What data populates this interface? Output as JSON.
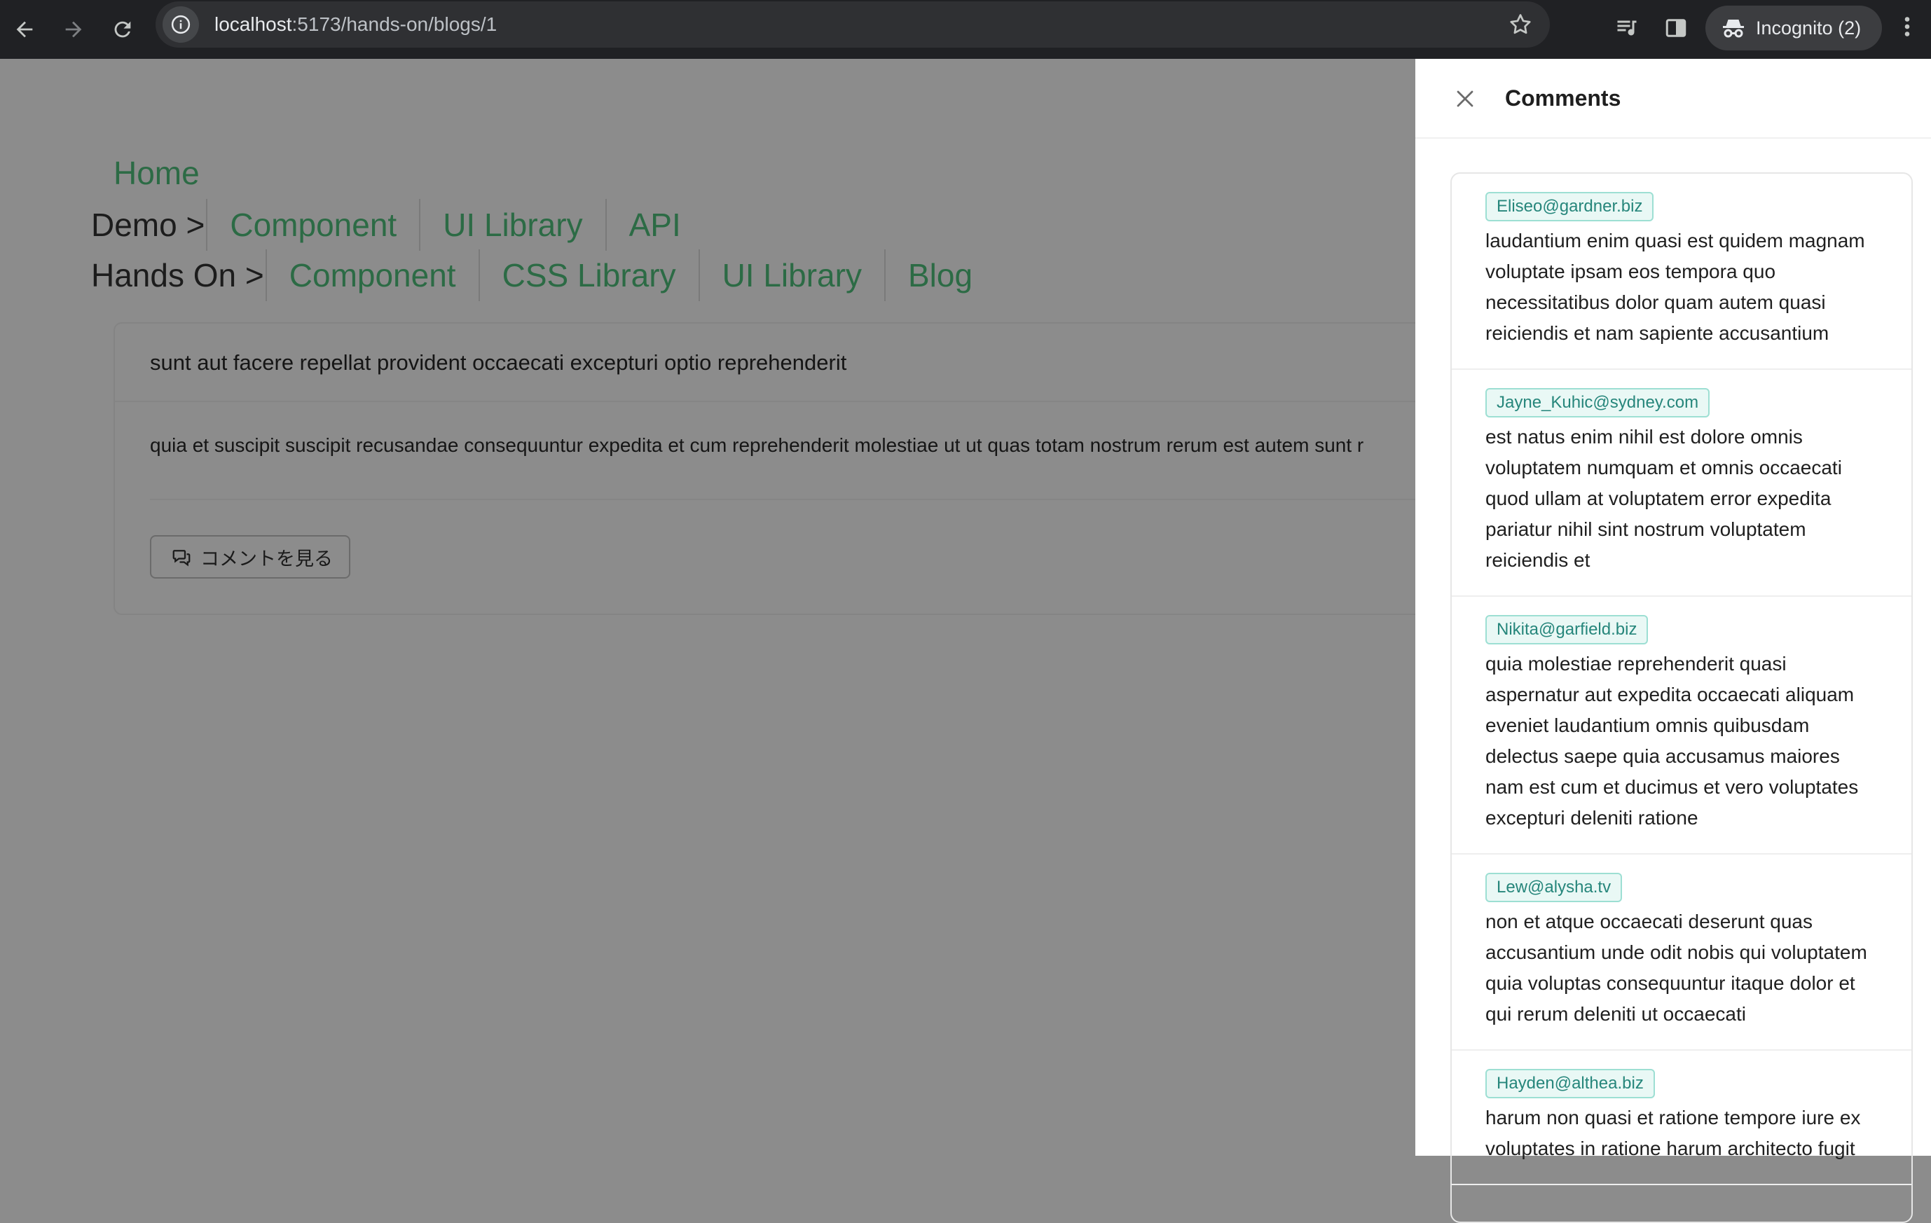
{
  "browser": {
    "url_host": "localhost",
    "url_path": ":5173/hands-on/blogs/1",
    "incognito_label": "Incognito (2)"
  },
  "nav": {
    "home": "Home",
    "demo_label": "Demo >",
    "demo_links": [
      "Component",
      "UI Library",
      "API"
    ],
    "handson_label": "Hands On >",
    "handson_links": [
      "Component",
      "CSS Library",
      "UI Library",
      "Blog"
    ]
  },
  "post": {
    "title": "sunt aut facere repellat provident occaecati excepturi optio reprehenderit",
    "body": "quia et suscipit suscipit recusandae consequuntur expedita et cum reprehenderit molestiae ut ut quas totam nostrum rerum est autem sunt r",
    "comment_button": "コメントを見る"
  },
  "drawer": {
    "title": "Comments",
    "comments": [
      {
        "email": "Eliseo@gardner.biz",
        "body": "laudantium enim quasi est quidem magnam voluptate ipsam eos tempora quo necessitatibus dolor quam autem quasi reiciendis et nam sapiente accusantium"
      },
      {
        "email": "Jayne_Kuhic@sydney.com",
        "body": "est natus enim nihil est dolore omnis voluptatem numquam et omnis occaecati quod ullam at voluptatem error expedita pariatur nihil sint nostrum voluptatem reiciendis et"
      },
      {
        "email": "Nikita@garfield.biz",
        "body": "quia molestiae reprehenderit quasi aspernatur aut expedita occaecati aliquam eveniet laudantium omnis quibusdam delectus saepe quia accusamus maiores nam est cum et ducimus et vero voluptates excepturi deleniti ratione"
      },
      {
        "email": "Lew@alysha.tv",
        "body": "non et atque occaecati deserunt quas accusantium unde odit nobis qui voluptatem quia voluptas consequuntur itaque dolor et qui rerum deleniti ut occaecati"
      },
      {
        "email": "Hayden@althea.biz",
        "body": "harum non quasi et ratione tempore iure ex voluptates in ratione harum architecto fugit"
      }
    ]
  }
}
